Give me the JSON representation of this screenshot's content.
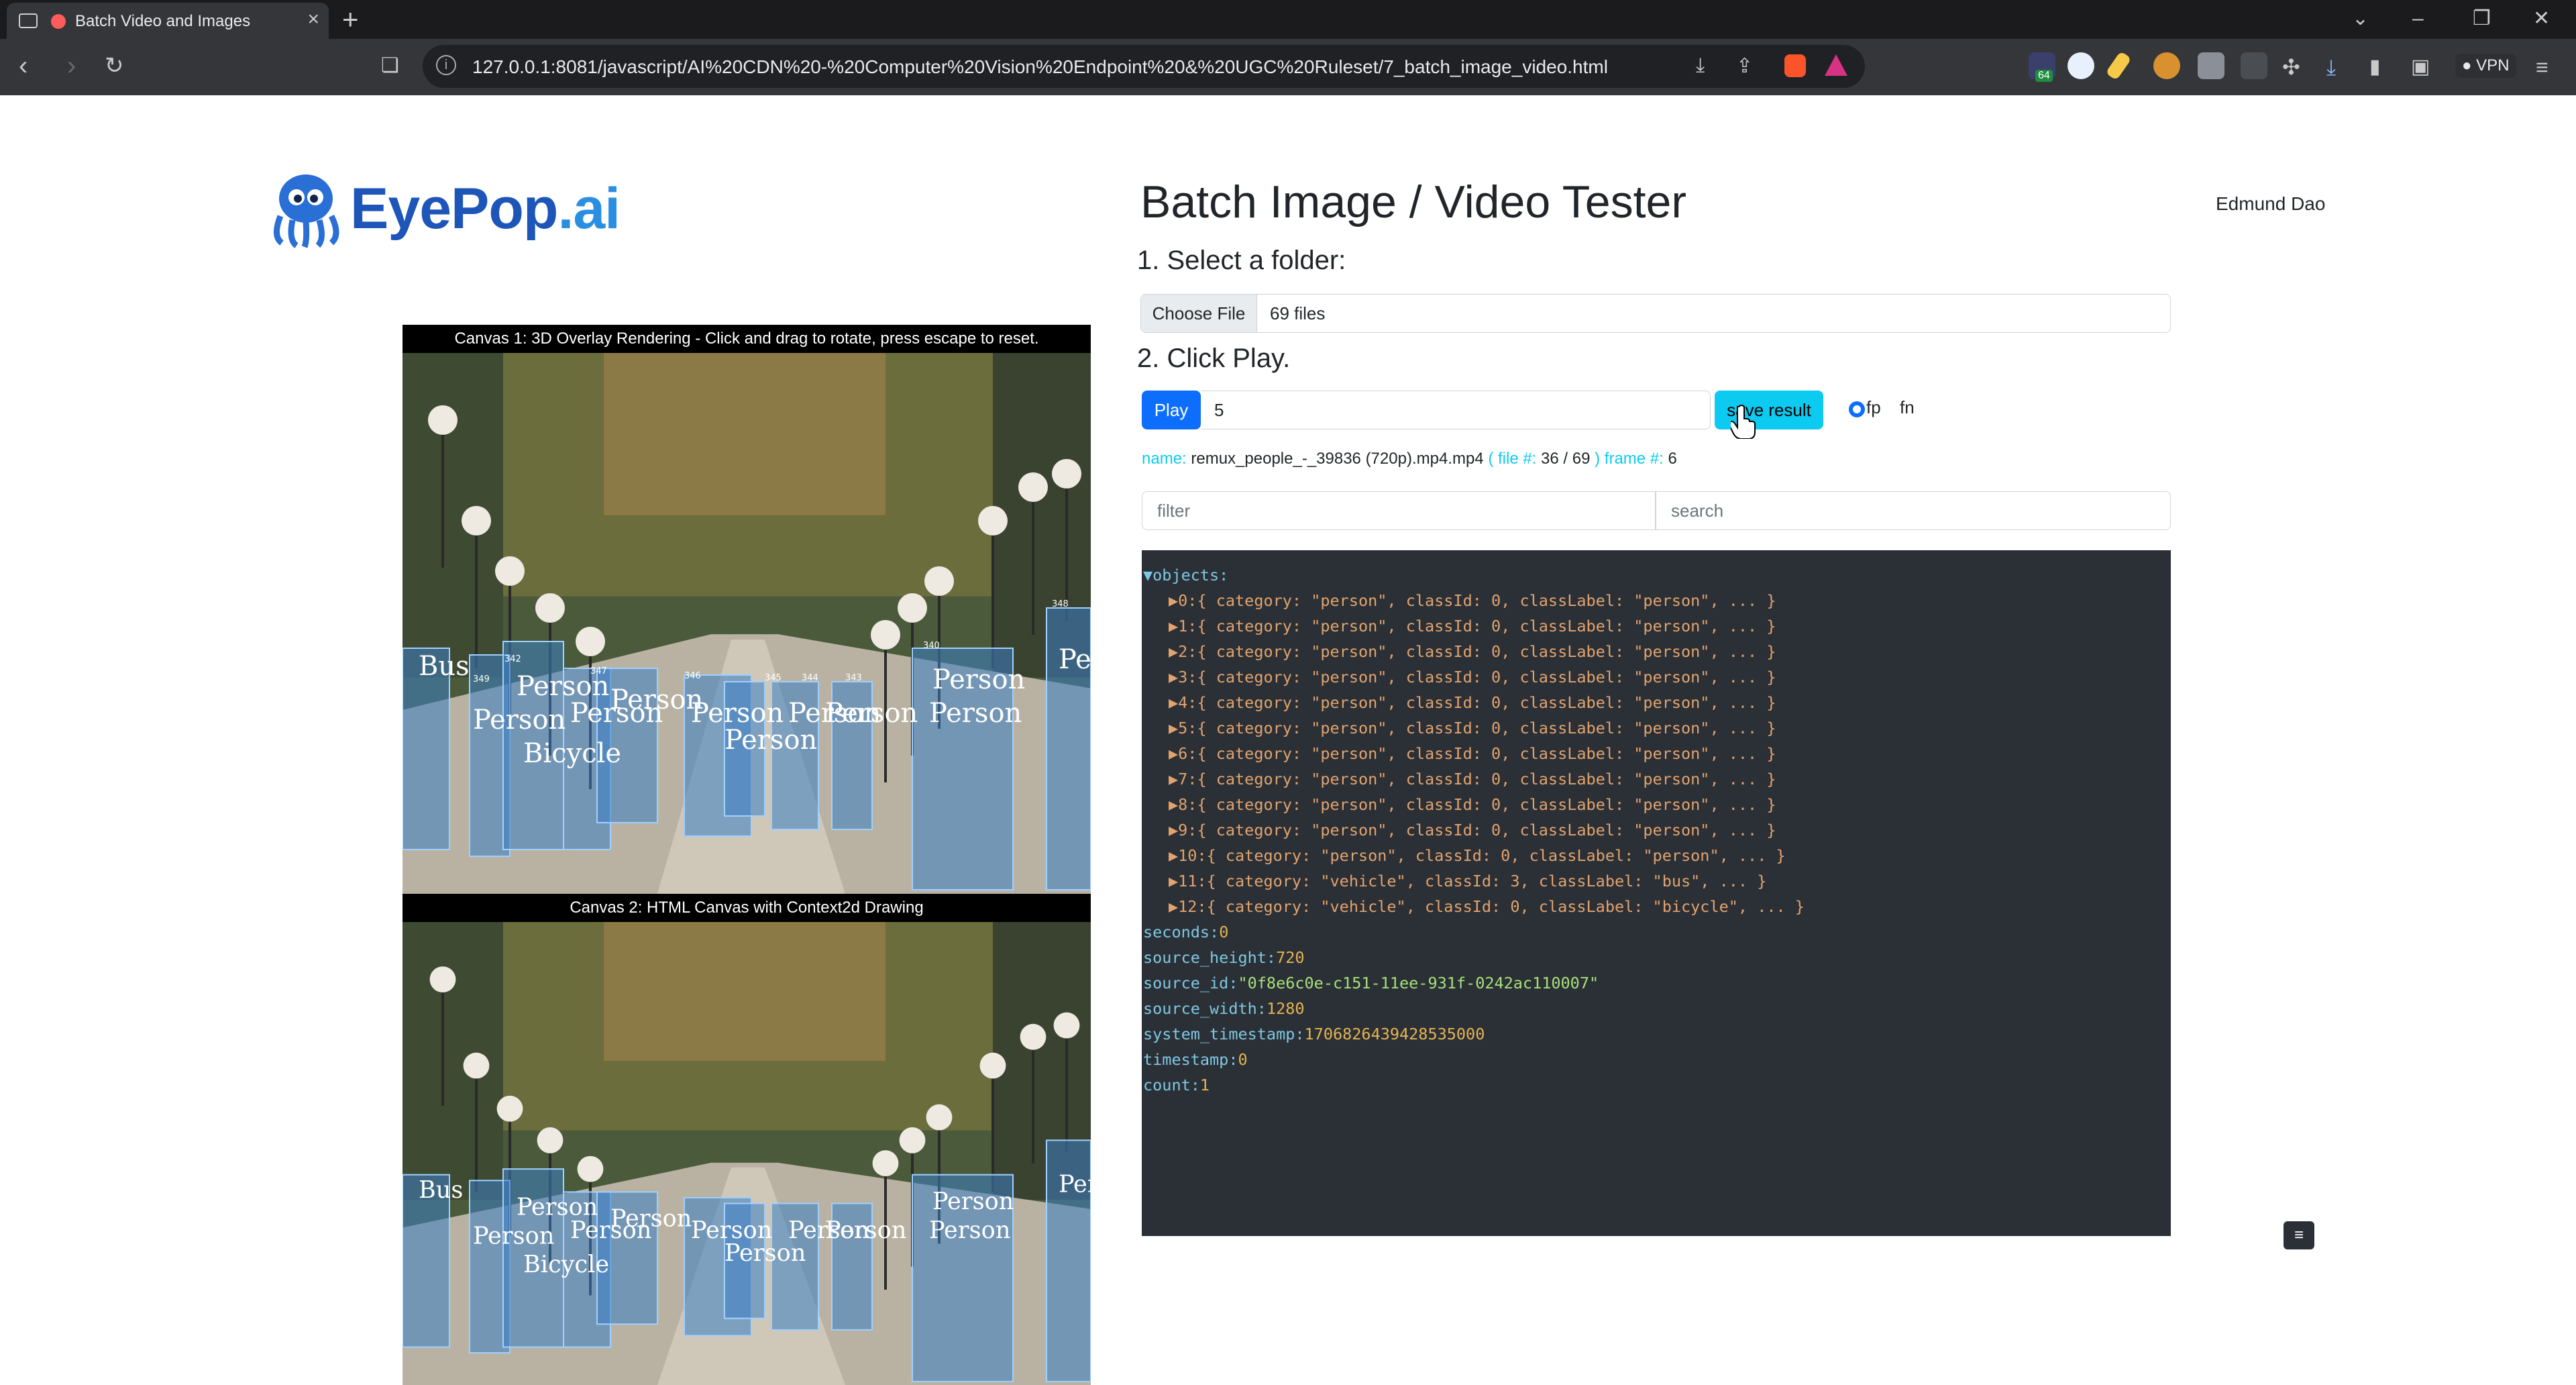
{
  "browser": {
    "tab_title": "Batch Video and Images",
    "url": "127.0.0.1:8081/javascript/AI%20CDN%20-%20Computer%20Vision%20Endpoint%20&%20UGC%20Ruleset/7_batch_image_video.html",
    "vpn_label": "VPN",
    "ext_badge": "64"
  },
  "header": {
    "logo_eye": "EyePop",
    "logo_ai": ".ai",
    "title": "Batch Image / Video Tester",
    "user_name": "Edmund Dao"
  },
  "steps": {
    "select_folder": "1. Select a folder:",
    "click_play": "2. Click Play."
  },
  "file_input": {
    "button_label": "Choose File",
    "value": "69 files"
  },
  "controls": {
    "play_label": "Play",
    "frame_value": "5",
    "save_label": "save result",
    "radio_fp": "fp",
    "radio_fn": "fn"
  },
  "info": {
    "name_key": "name:",
    "name_value": "remux_people_-_39836 (720p).mp4.mp4",
    "file_key": "( file #:",
    "file_value": "36 / 69",
    "close_paren": ")",
    "frame_key": "frame #:",
    "frame_value": "6"
  },
  "filter": {
    "filter_placeholder": "filter",
    "search_placeholder": "search"
  },
  "json_view": {
    "objects_label": "▼objects:",
    "objects": [
      "▶0:{ category: \"person\", classId: 0, classLabel: \"person\", ... }",
      "▶1:{ category: \"person\", classId: 0, classLabel: \"person\", ... }",
      "▶2:{ category: \"person\", classId: 0, classLabel: \"person\", ... }",
      "▶3:{ category: \"person\", classId: 0, classLabel: \"person\", ... }",
      "▶4:{ category: \"person\", classId: 0, classLabel: \"person\", ... }",
      "▶5:{ category: \"person\", classId: 0, classLabel: \"person\", ... }",
      "▶6:{ category: \"person\", classId: 0, classLabel: \"person\", ... }",
      "▶7:{ category: \"person\", classId: 0, classLabel: \"person\", ... }",
      "▶8:{ category: \"person\", classId: 0, classLabel: \"person\", ... }",
      "▶9:{ category: \"person\", classId: 0, classLabel: \"person\", ... }",
      "▶10:{ category: \"person\", classId: 0, classLabel: \"person\", ... }",
      "▶11:{ category: \"vehicle\", classId: 3, classLabel: \"bus\", ... }",
      "▶12:{ category: \"vehicle\", classId: 0, classLabel: \"bicycle\", ... }"
    ],
    "fields": [
      {
        "key": "seconds:",
        "value": "0",
        "type": "num"
      },
      {
        "key": "source_height:",
        "value": "720",
        "type": "num"
      },
      {
        "key": "source_id:",
        "value": "\"0f8e6c0e-c151-11ee-931f-0242ac110007\"",
        "type": "str"
      },
      {
        "key": "source_width:",
        "value": "1280",
        "type": "num"
      },
      {
        "key": "system_timestamp:",
        "value": "1706826439428535000",
        "type": "num"
      },
      {
        "key": "timestamp:",
        "value": "0",
        "type": "num"
      },
      {
        "key": "count:",
        "value": "1",
        "type": "num"
      }
    ],
    "toggle_label": "≡"
  },
  "canvas1": {
    "title": "Canvas 1: 3D Overlay Rendering - Click and drag to rotate, press escape to reset.",
    "track_ids": [
      "349",
      "342",
      "347",
      "346",
      "345",
      "344",
      "343",
      "340",
      "348"
    ]
  },
  "canvas2": {
    "title": "Canvas 2: HTML Canvas with Context2d Drawing"
  },
  "labels": {
    "bus": "Bus",
    "person": "Person",
    "bicycle": "Bicycle",
    "per_partial": "Per"
  },
  "colors": {
    "primary": "#0d6efd",
    "info": "#0dcaf0",
    "json_bg": "#2b3036",
    "box_fill": "#3d7fc4"
  }
}
